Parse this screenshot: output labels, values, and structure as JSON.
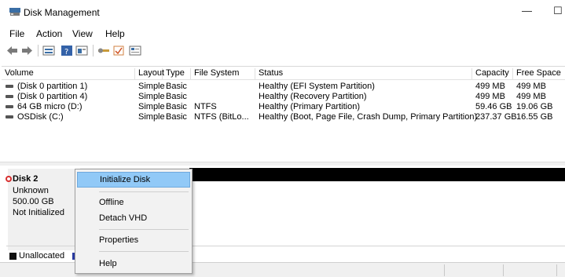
{
  "window": {
    "title": "Disk Management",
    "minimize_glyph": "—",
    "maximize_glyph": "☐"
  },
  "menu": [
    "File",
    "Action",
    "View",
    "Help"
  ],
  "toolbar_icons": [
    "back-icon",
    "forward-icon",
    "disk-list-icon",
    "help-icon",
    "properties-icon",
    "connect-icon",
    "check-icon",
    "settings-icon"
  ],
  "table": {
    "headers": [
      "Volume",
      "Layout",
      "Type",
      "File System",
      "Status",
      "Capacity",
      "Free Space"
    ],
    "rows": [
      {
        "volume": "(Disk 0 partition 1)",
        "layout": "Simple",
        "type": "Basic",
        "fs": "",
        "status": "Healthy (EFI System Partition)",
        "capacity": "499 MB",
        "free": "499 MB"
      },
      {
        "volume": "(Disk 0 partition 4)",
        "layout": "Simple",
        "type": "Basic",
        "fs": "",
        "status": "Healthy (Recovery Partition)",
        "capacity": "499 MB",
        "free": "499 MB"
      },
      {
        "volume": "64 GB micro (D:)",
        "layout": "Simple",
        "type": "Basic",
        "fs": "NTFS",
        "status": "Healthy (Primary Partition)",
        "capacity": "59.46 GB",
        "free": "19.06 GB"
      },
      {
        "volume": "OSDisk (C:)",
        "layout": "Simple",
        "type": "Basic",
        "fs": "NTFS (BitLo...",
        "status": "Healthy (Boot, Page File, Crash Dump, Primary Partition)",
        "capacity": "237.37 GB",
        "free": "16.55 GB"
      }
    ]
  },
  "disk": {
    "name": "Disk 2",
    "kind": "Unknown",
    "size": "500.00 GB",
    "state": "Not Initialized"
  },
  "context_menu": {
    "items": [
      "Initialize Disk",
      "Offline",
      "Detach VHD",
      "Properties",
      "Help"
    ],
    "highlighted": "Initialize Disk"
  },
  "legend": {
    "unallocated": "Unallocated"
  },
  "colors": {
    "highlight": "#91c9f7",
    "unallocated": "#111111",
    "primary": "#2a3aa0",
    "error": "#d83030"
  }
}
